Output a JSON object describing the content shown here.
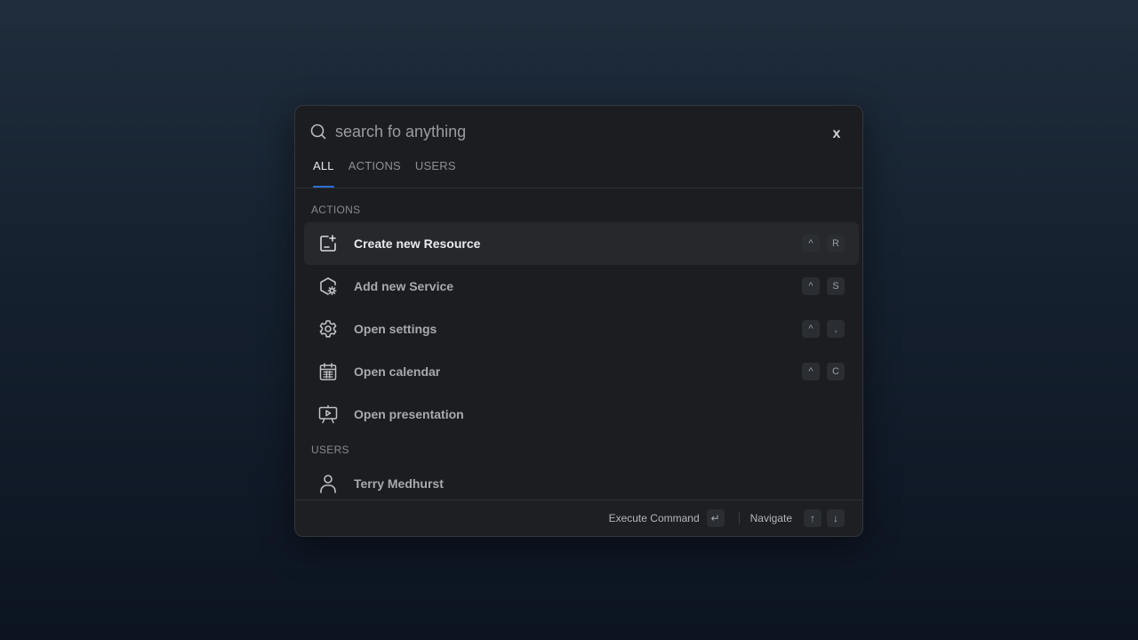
{
  "search": {
    "value": "search fo anything",
    "close_label": "x"
  },
  "tabs": [
    {
      "label": "ALL",
      "active": true
    },
    {
      "label": "ACTIONS",
      "active": false
    },
    {
      "label": "USERS",
      "active": false
    }
  ],
  "sections": {
    "actions_label": "ACTIONS",
    "users_label": "USERS"
  },
  "actions": [
    {
      "label": "Create new Resource",
      "icon": "document-plus-icon",
      "shortcut": [
        "^",
        "R"
      ],
      "selected": true
    },
    {
      "label": "Add new Service",
      "icon": "hexagon-gear-icon",
      "shortcut": [
        "^",
        "S"
      ],
      "selected": false
    },
    {
      "label": "Open settings",
      "icon": "gear-icon",
      "shortcut": [
        "^",
        ","
      ],
      "selected": false
    },
    {
      "label": "Open calendar",
      "icon": "calendar-icon",
      "shortcut": [
        "^",
        "C"
      ],
      "selected": false
    },
    {
      "label": "Open presentation",
      "icon": "presentation-icon",
      "shortcut": [],
      "selected": false
    }
  ],
  "users": [
    {
      "label": "Terry Medhurst",
      "icon": "user-icon"
    }
  ],
  "footer": {
    "execute_label": "Execute Command",
    "execute_key": "↵",
    "navigate_label": "Navigate",
    "up_key": "↑",
    "down_key": "↓"
  },
  "colors": {
    "accent": "#2d6fd6",
    "panel": "#1b1d20",
    "selected_row": "#26282c"
  }
}
